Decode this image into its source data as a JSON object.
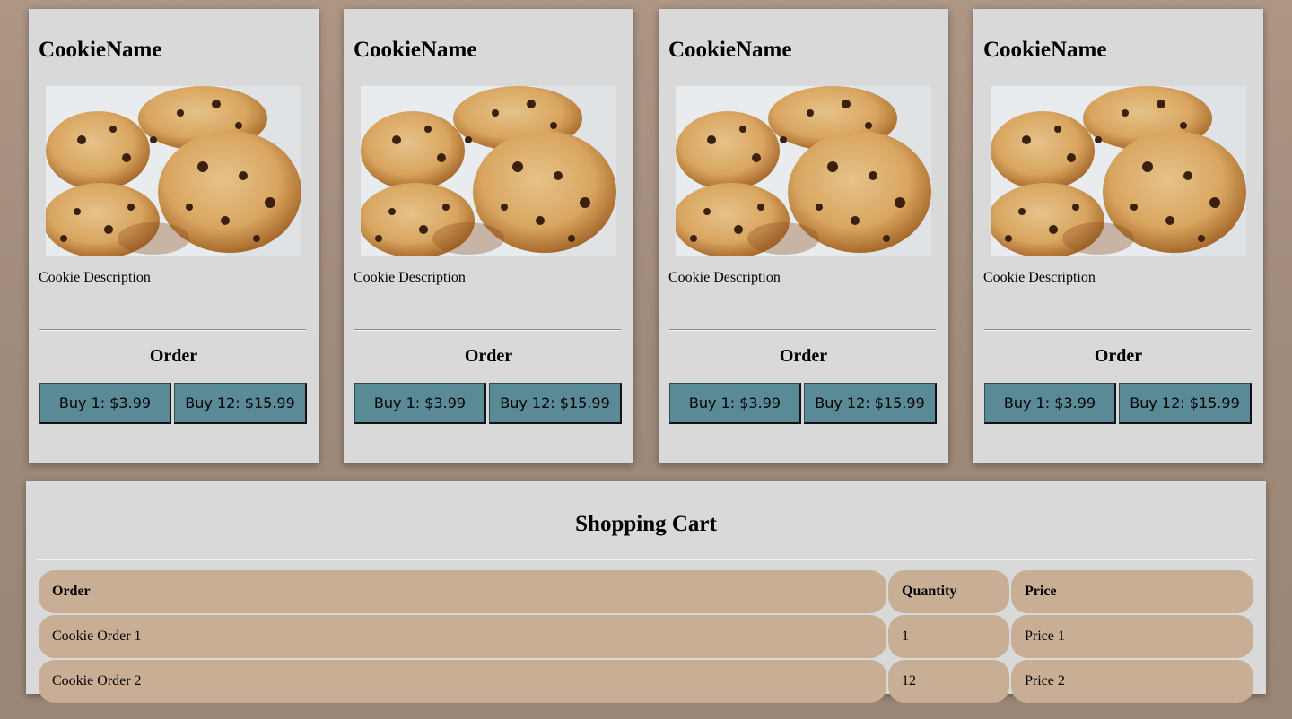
{
  "cards": [
    {
      "name": "CookieName",
      "description": "Cookie Description",
      "order_heading": "Order",
      "buy_one_label": "Buy 1: $3.99",
      "buy_twelve_label": "Buy 12: $15.99"
    },
    {
      "name": "CookieName",
      "description": "Cookie Description",
      "order_heading": "Order",
      "buy_one_label": "Buy 1: $3.99",
      "buy_twelve_label": "Buy 12: $15.99"
    },
    {
      "name": "CookieName",
      "description": "Cookie Description",
      "order_heading": "Order",
      "buy_one_label": "Buy 1: $3.99",
      "buy_twelve_label": "Buy 12: $15.99"
    },
    {
      "name": "CookieName",
      "description": "Cookie Description",
      "order_heading": "Order",
      "buy_one_label": "Buy 1: $3.99",
      "buy_twelve_label": "Buy 12: $15.99"
    }
  ],
  "cart": {
    "title": "Shopping Cart",
    "headers": {
      "order": "Order",
      "quantity": "Quantity",
      "price": "Price"
    },
    "rows": [
      {
        "order": "Cookie Order 1",
        "quantity": "1",
        "price": "Price 1"
      },
      {
        "order": "Cookie Order 2",
        "quantity": "12",
        "price": "Price 2"
      }
    ]
  },
  "colors": {
    "background": "#a8917f",
    "card": "#d9d9d9",
    "button": "#5a8a96",
    "table_cell": "#c8ae94"
  }
}
